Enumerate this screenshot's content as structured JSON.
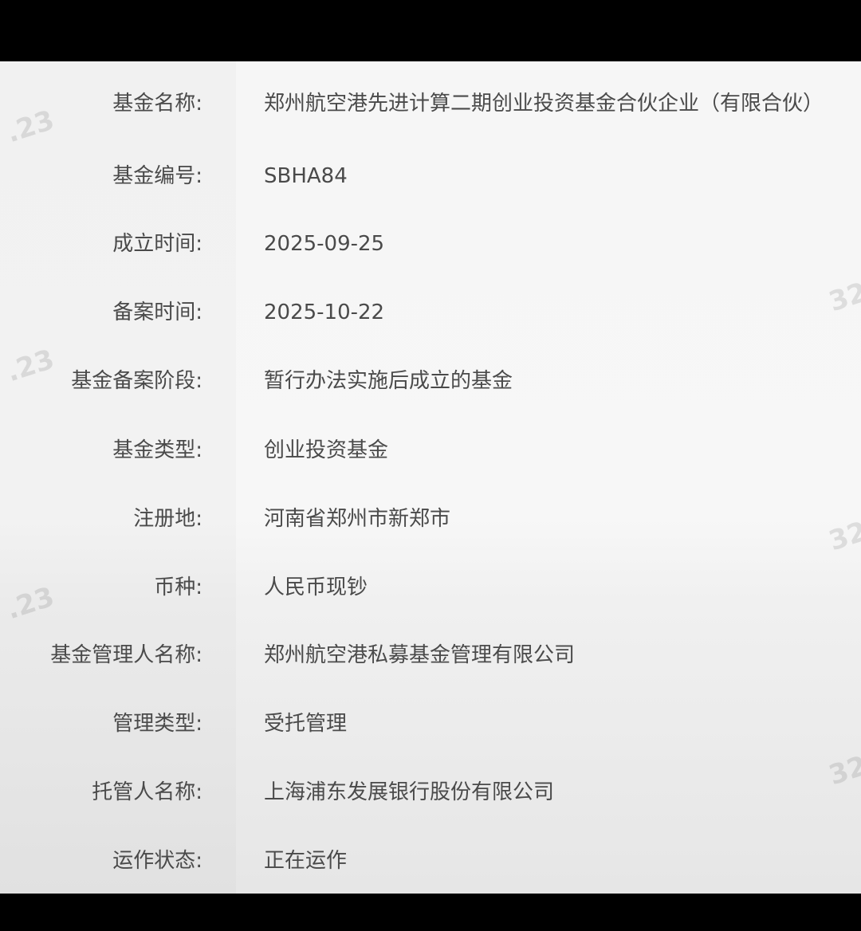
{
  "fund_info": {
    "rows": [
      {
        "label": "基金名称:",
        "value": "郑州航空港先进计算二期创业投资基金合伙企业（有限合伙）"
      },
      {
        "label": "基金编号:",
        "value": "SBHA84"
      },
      {
        "label": "成立时间:",
        "value": "2025-09-25"
      },
      {
        "label": "备案时间:",
        "value": "2025-10-22"
      },
      {
        "label": "基金备案阶段:",
        "value": "暂行办法实施后成立的基金"
      },
      {
        "label": "基金类型:",
        "value": "创业投资基金"
      },
      {
        "label": "注册地:",
        "value": "河南省郑州市新郑市"
      },
      {
        "label": "币种:",
        "value": "人民币现钞"
      },
      {
        "label": "基金管理人名称:",
        "value": "郑州航空港私募基金管理有限公司"
      },
      {
        "label": "管理类型:",
        "value": "受托管理"
      },
      {
        "label": "托管人名称:",
        "value": "上海浦东发展银行股份有限公司"
      },
      {
        "label": "运作状态:",
        "value": "正在运作"
      }
    ]
  },
  "watermarks": {
    "left_text": ".23",
    "right_text": "32"
  },
  "colors": {
    "text": "#4a4a4a",
    "background": "#f6f6f6",
    "label_column": "#f1f1f1",
    "letterbox": "#000000"
  }
}
